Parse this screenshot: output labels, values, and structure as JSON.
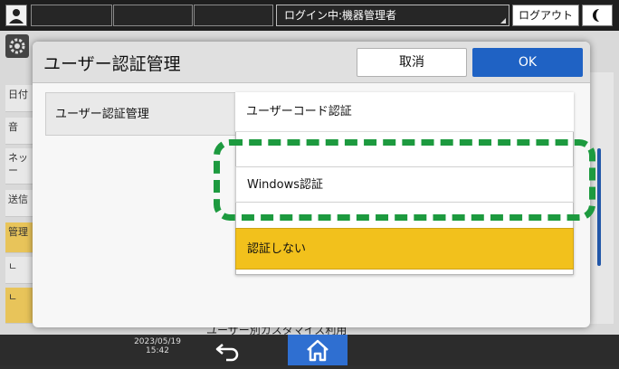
{
  "status_bar": {
    "login_status": "ログイン中:機器管理者",
    "logout_label": "ログアウト",
    "icons": {
      "user": "user-icon",
      "night": "moon-icon"
    }
  },
  "background_screen": {
    "left_items": [
      "日付",
      "音",
      "ネッ ー",
      "送信",
      "管理",
      "ㄴ",
      "ㄴ"
    ],
    "footer_text": "ユーザー別カスタマイズ利用"
  },
  "dialog": {
    "title": "ユーザー認証管理",
    "cancel_label": "取消",
    "ok_label": "OK",
    "setting_label": "ユーザー認証管理",
    "options": [
      {
        "label": "ユーザーコード認証",
        "selected": false
      },
      {
        "label": "Windows認証",
        "selected": false
      },
      {
        "label": "認証しない",
        "selected": true
      }
    ],
    "highlight_color": "#1d9a3f",
    "selected_color": "#f2c11c"
  },
  "bottom_bar": {
    "date": "2023/05/19",
    "time": "15:42",
    "icons": {
      "back": "back-arrow-icon",
      "home": "home-icon"
    },
    "home_color": "#2f6fd1"
  }
}
